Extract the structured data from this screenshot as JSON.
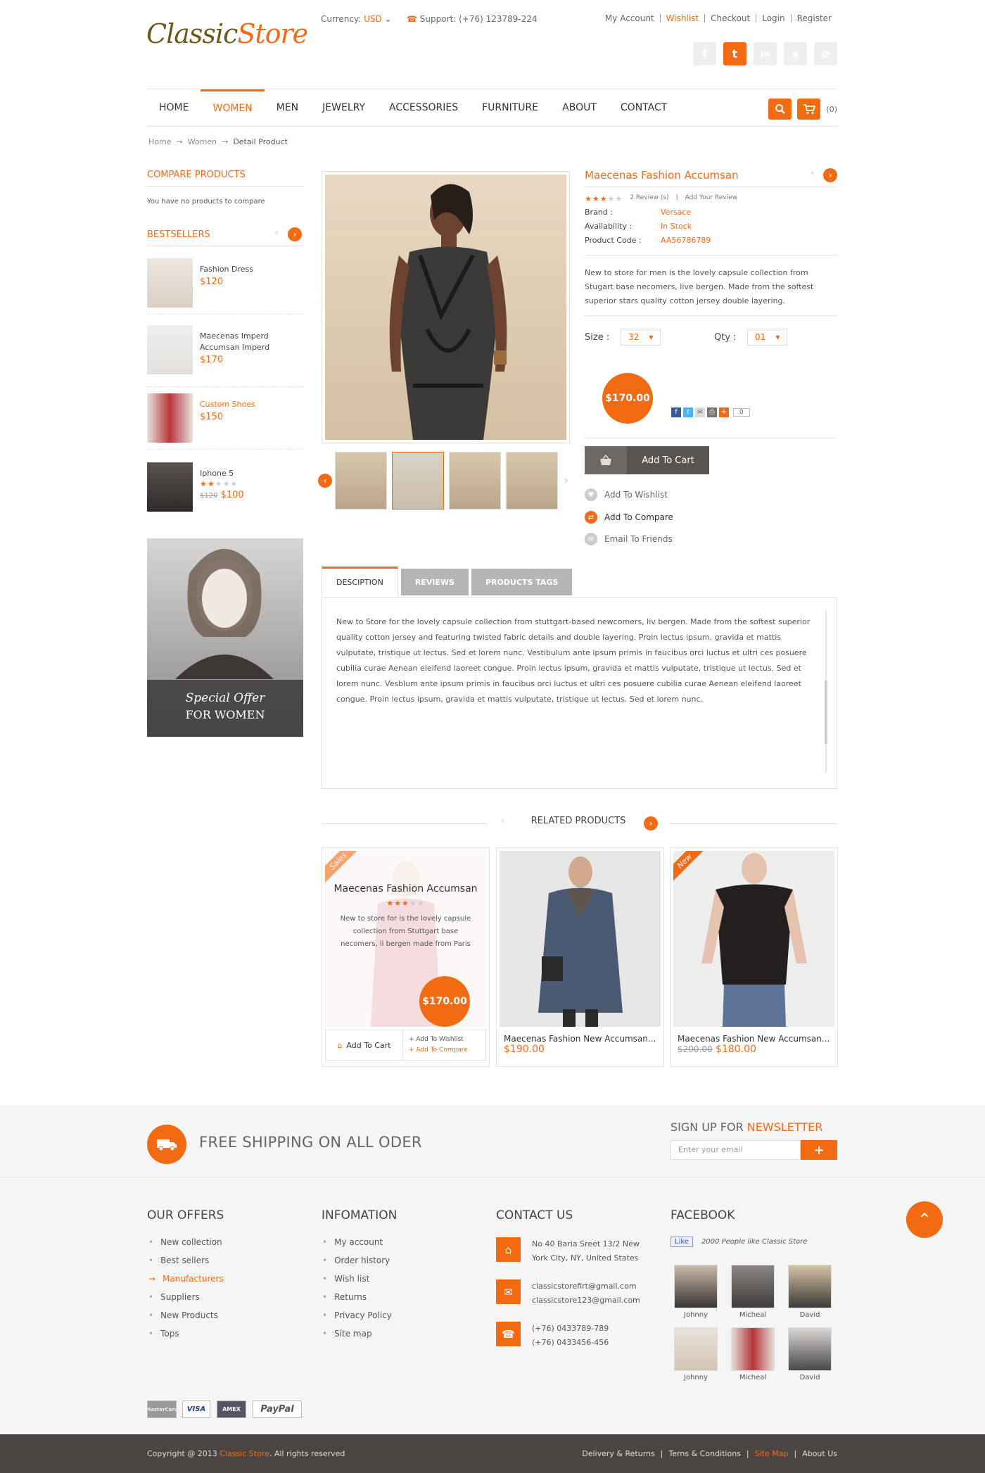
{
  "header": {
    "logo_part1": "Classic",
    "logo_part2": "Store",
    "currency_label": "Currency:",
    "currency_value": "USD",
    "support_label": "Support:",
    "support_phone": "(+76) 123789-224",
    "links": [
      "My Account",
      "Wishlist",
      "Checkout",
      "Login",
      "Register"
    ],
    "social": [
      "f",
      "t",
      "in",
      "rss",
      "dribbble"
    ]
  },
  "nav": {
    "items": [
      "HOME",
      "WOMEN",
      "MEN",
      "JEWELRY",
      "ACCESSORIES",
      "FURNITURE",
      "ABOUT",
      "CONTACT"
    ],
    "active": "WOMEN",
    "cart_count": "(0)"
  },
  "breadcrumb": [
    "Home",
    "Women",
    "Detail Product"
  ],
  "sidebar": {
    "compare_title": "COMPARE PRODUCTS",
    "compare_text": "You have no products to compare",
    "bestsellers_title": "BESTSELLERS",
    "items": [
      {
        "name": "Fashion Dress",
        "price": "$120"
      },
      {
        "name": "Maecenas Imperd Accumsan Imperd",
        "price": "$170"
      },
      {
        "name": "Custom Shoes",
        "price": "$150"
      },
      {
        "name": "Iphone 5",
        "old": "$120",
        "price": "$100"
      }
    ],
    "offer_line1": "Special Offer",
    "offer_line2": "FOR WOMEN"
  },
  "product": {
    "title": "Maecenas Fashion Accumsan",
    "reviews": "2 Review (s)",
    "add_review": "Add Your Review",
    "rating": 3,
    "brand_label": "Brand :",
    "brand": "Versace",
    "availability_label": "Availability :",
    "availability": "In Stock",
    "code_label": "Product Code :",
    "code": "AA56786789",
    "desc": "New to store for men is the lovely capsule collection from Stugart base necomers, live bergen. Made from the softest superior stars quality cotton jersey  double layering.",
    "size_label": "Size :",
    "size": "32",
    "qty_label": "Qty :",
    "qty": "01",
    "price": "$170.00",
    "share_count": "0",
    "add_to_cart": "Add To Cart",
    "wishlist": "Add To Wishlist",
    "compare": "Add To Compare",
    "email": "Email To Friends"
  },
  "tabs": {
    "items": [
      "DESCIPTION",
      "REVIEWS",
      "PRODUCTS TAGS"
    ],
    "text": "New to Store for the lovely capsule collection from stuttgart-based newcomers, liv bergen. Made from the softest superior quality cotton jersey and featuring twisted fabric details and double layering. Proin lectus ipsum, gravida et mattis vulputate, tristique ut lectus. Sed et lorem nunc. Vestibulum ante ipsum primis in faucibus orci luctus et ultri ces posuere cubilia curae Aenean eleifend laoreet congue. Proin lectus ipsum, gravida et mattis vulputate, tristique ut lectus. Sed et lorem nunc. Vesblum ante ipsum primis in faucibus orci luctus et ultri ces posuere cubilia curae Aenean eleifend laoreet congue. Proin lectus ipsum, gravida et mattis vulputate, tristique ut lectus. Sed et lorem nunc."
  },
  "related": {
    "title": "RELATED PRODUCTS",
    "items": [
      {
        "ribbon": "Sales",
        "name": "Maecenas Fashion Accumsan",
        "desc": "New to store for is the lovely capsule collection from Stuttgart base necomers, li bergen made from Paris",
        "price": "$170.00",
        "add_cart": "Add To Cart",
        "wishlist": "+ Add To Wishlist",
        "compare": "+ Add To Compare"
      },
      {
        "name": "Maecenas Fashion New Accumsan...",
        "price": "$190.00"
      },
      {
        "ribbon": "New",
        "name": "Maecenas Fashion New Accumsan...",
        "old": "$200.00",
        "price": "$180.00"
      }
    ]
  },
  "shipping": {
    "text": "FREE SHIPPING ON ALL ODER",
    "signup": "SIGN UP FOR",
    "newsletter": "NEWSLETTER",
    "placeholder": "Enter your email",
    "btn": "+"
  },
  "footer": {
    "offers_title": "OUR OFFERS",
    "offers": [
      "New collection",
      "Best sellers",
      "Manufacturers",
      "Suppliers",
      "New Products",
      "Tops"
    ],
    "info_title": "INFOMATION",
    "info": [
      "My account",
      "Order history",
      "Wish list",
      "Returns",
      "Privacy Policy",
      "Site map"
    ],
    "contact_title": "CONTACT US",
    "address1": "No 40 Baria Sreet 13/2 New",
    "address2": "York City, NY, United States",
    "email1": "classicstorefirt@gmail.com",
    "email2": "classicstore123@gmail.com",
    "phone1": "(+76) 0433789-789",
    "phone2": "(+76) 0433456-456",
    "fb_title": "FACEBOOK",
    "fb_like": "Like",
    "fb_text": "2000 People like Classic Store",
    "fb_names": [
      "Johnny",
      "Micheal",
      "David",
      "Johnny",
      "Micheal",
      "David"
    ],
    "payments": [
      "MasterCard",
      "VISA",
      "AMEX",
      "PayPal"
    ]
  },
  "bottom": {
    "copy1": "Copyright @ 2013 ",
    "brand": "Classic Store",
    "copy2": ". All rights reserved",
    "links": [
      "Delivery & Returns",
      "Terns & Conditions",
      "Site Map",
      "About Us"
    ]
  }
}
